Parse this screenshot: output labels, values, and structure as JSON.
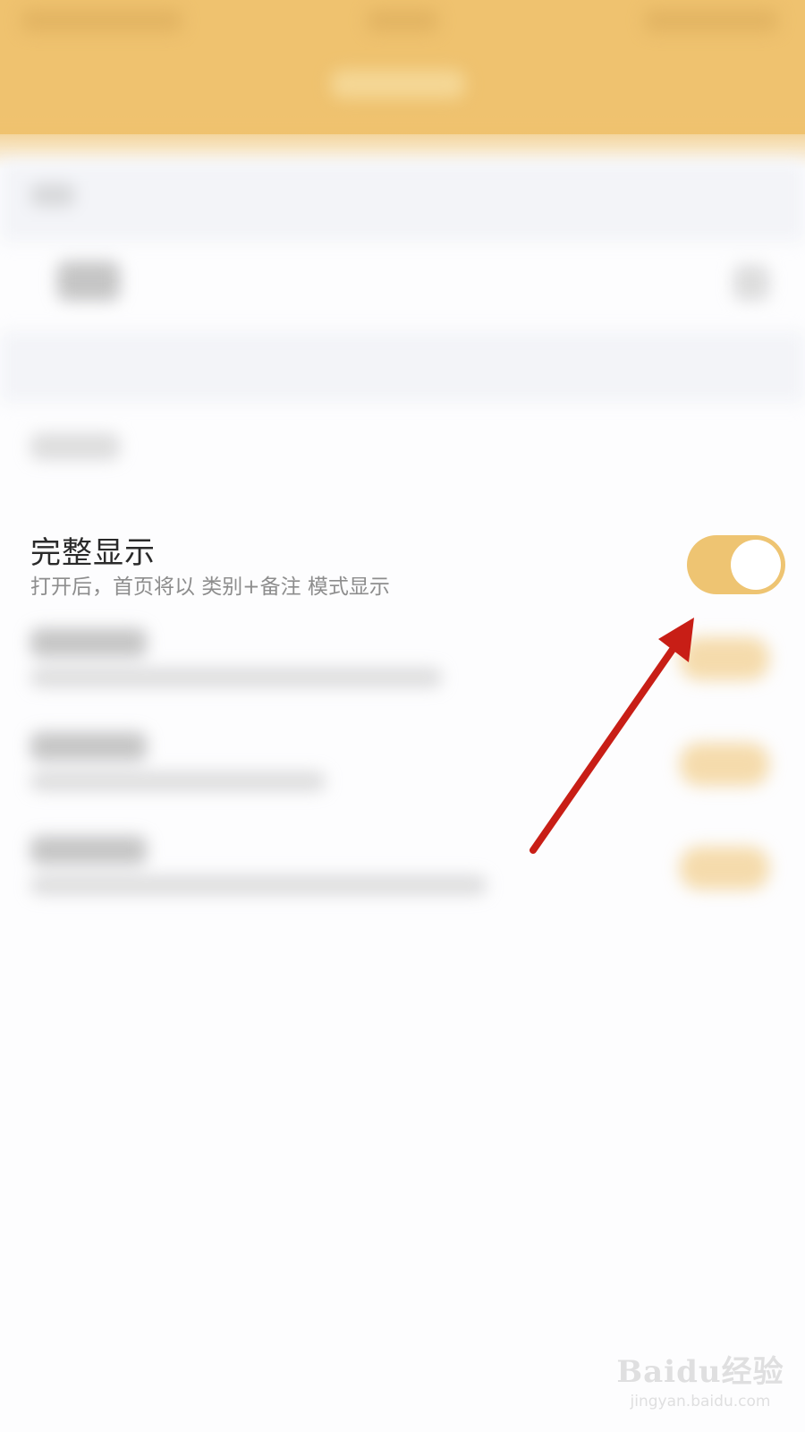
{
  "setting": {
    "title": "完整显示",
    "description": "打开后，首页将以 类别+备注 模式显示",
    "enabled": true
  },
  "colors": {
    "header": "#efc26f",
    "toggle_on": "#eec472",
    "annotation_arrow": "#c81e16"
  },
  "watermark": {
    "brand": "Baidu经验",
    "url": "jingyan.baidu.com"
  }
}
